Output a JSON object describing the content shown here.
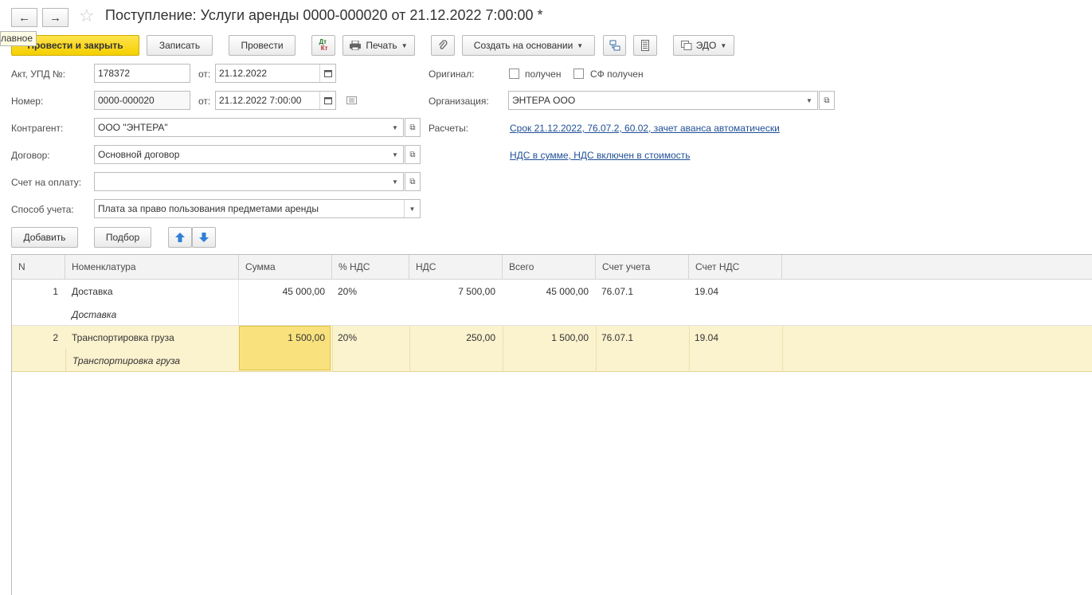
{
  "window": {
    "title": "Поступление: Услуги аренды 0000-000020 от 21.12.2022 7:00:00 *",
    "tooltip": "лавное"
  },
  "toolbar": {
    "post_close": "Провести и закрыть",
    "save": "Записать",
    "post": "Провести",
    "print": "Печать",
    "create_based": "Создать на основании",
    "edo": "ЭДО"
  },
  "form": {
    "act_label": "Акт, УПД №:",
    "act_value": "178372",
    "from_label": "от:",
    "act_date": "21.12.2022",
    "number_label": "Номер:",
    "number_value": "0000-000020",
    "from_label2": "от:",
    "number_date": "21.12.2022  7:00:00",
    "contractor_label": "Контрагент:",
    "contractor_value": "ООО \"ЭНТЕРА\"",
    "contract_label": "Договор:",
    "contract_value": "Основной договор",
    "invoice_label": "Счет на оплату:",
    "invoice_value": "",
    "method_label": "Способ учета:",
    "method_value": "Плата за право пользования предметами аренды",
    "original_label": "Оригинал:",
    "received_label": "получен",
    "sf_received_label": "СФ получен",
    "org_label": "Организация:",
    "org_value": "ЭНТЕРА ООО",
    "settlements_label": "Расчеты:",
    "settlements_link": "Срок 21.12.2022, 76.07.2, 60.02, зачет аванса автоматически",
    "vat_link": "НДС в сумме, НДС включен в стоимость"
  },
  "table_toolbar": {
    "add": "Добавить",
    "pick": "Подбор"
  },
  "table": {
    "columns": [
      "N",
      "Номенклатура",
      "Сумма",
      "% НДС",
      "НДС",
      "Всего",
      "Счет учета",
      "Счет НДС"
    ],
    "rows": [
      {
        "n": "1",
        "name": "Доставка",
        "content": "Доставка",
        "sum": "45 000,00",
        "vat_rate": "20%",
        "vat": "7 500,00",
        "total": "45 000,00",
        "account": "76.07.1",
        "vat_account": "19.04"
      },
      {
        "n": "2",
        "name": "Транспортировка груза",
        "content": "Транспортировка груза",
        "sum": "1 500,00",
        "vat_rate": "20%",
        "vat": "250,00",
        "total": "1 500,00",
        "account": "76.07.1",
        "vat_account": "19.04"
      }
    ]
  },
  "colors": {
    "primary_button": "#f5cf00",
    "selected_row": "#fbf2ce",
    "active_cell": "#f9e27e",
    "link": "#1f4f96"
  }
}
